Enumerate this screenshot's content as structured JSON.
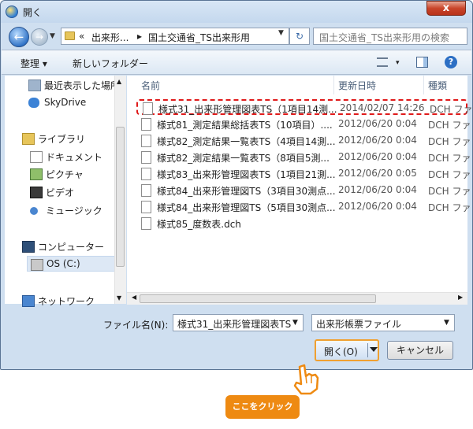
{
  "window": {
    "title": "開く",
    "close_label": "x"
  },
  "address": {
    "crumbs": [
      "«",
      "出来形...",
      "▸",
      "国土交通省_TS出来形用"
    ],
    "search_placeholder": "国土交通省_TS出来形用の検索"
  },
  "toolbar": {
    "organize": "整理 ▾",
    "new_folder": "新しいフォルダー",
    "view_caret": "▾",
    "help": "?"
  },
  "nav": {
    "items": [
      {
        "label": "最近表示した場所",
        "icon": "recent-places-icon"
      },
      {
        "label": "SkyDrive",
        "icon": "skydrive-icon"
      },
      {
        "label": "ライブラリ",
        "icon": "libraries-icon"
      },
      {
        "label": "ドキュメント",
        "icon": "documents-icon"
      },
      {
        "label": "ピクチャ",
        "icon": "pictures-icon"
      },
      {
        "label": "ビデオ",
        "icon": "videos-icon"
      },
      {
        "label": "ミュージック",
        "icon": "music-icon"
      },
      {
        "label": "コンピューター",
        "icon": "computer-icon"
      },
      {
        "label": "OS (C:)",
        "icon": "drive-icon"
      },
      {
        "label": "ネットワーク",
        "icon": "network-icon"
      }
    ]
  },
  "files": {
    "headers": {
      "name": "名前",
      "date": "更新日時",
      "type": "種類"
    },
    "rows": [
      {
        "name": "様式31_出来形管理図表TS（1項目14測...",
        "date": "2014/02/07 14:26",
        "type": "DCH ファ"
      },
      {
        "name": "様式81_測定結果総括表TS（10項目）....",
        "date": "2012/06/20 0:04",
        "type": "DCH ファ"
      },
      {
        "name": "様式82_測定結果一覧表TS（4項目14測...",
        "date": "2012/06/20 0:04",
        "type": "DCH ファ"
      },
      {
        "name": "様式82_測定結果一覧表TS（8項目5測...",
        "date": "2012/06/20 0:04",
        "type": "DCH ファ"
      },
      {
        "name": "様式83_出来形管理図表TS（1項目21測...",
        "date": "2012/06/20 0:05",
        "type": "DCH ファ"
      },
      {
        "name": "様式84_出来形管理図TS（3項目30測点...",
        "date": "2012/06/20 0:04",
        "type": "DCH ファ"
      },
      {
        "name": "様式84_出来形管理図TS（5項目30測点...",
        "date": "2012/06/20 0:04",
        "type": "DCH ファ"
      },
      {
        "name": "様式85_度数表.dch",
        "date": "",
        "type": ""
      }
    ]
  },
  "bottom": {
    "filename_label": "ファイル名(N):",
    "filename_value": "様式31_出来形管理図表TS",
    "filetype_value": "出来形帳票ファイル",
    "open_label": "開く(O)",
    "cancel_label": "キャンセル"
  },
  "callout": {
    "text": "ここをクリック",
    "color": "#ee8a12"
  },
  "colors": {
    "highlight": "#e01a1a",
    "accent": "#f0a030"
  }
}
